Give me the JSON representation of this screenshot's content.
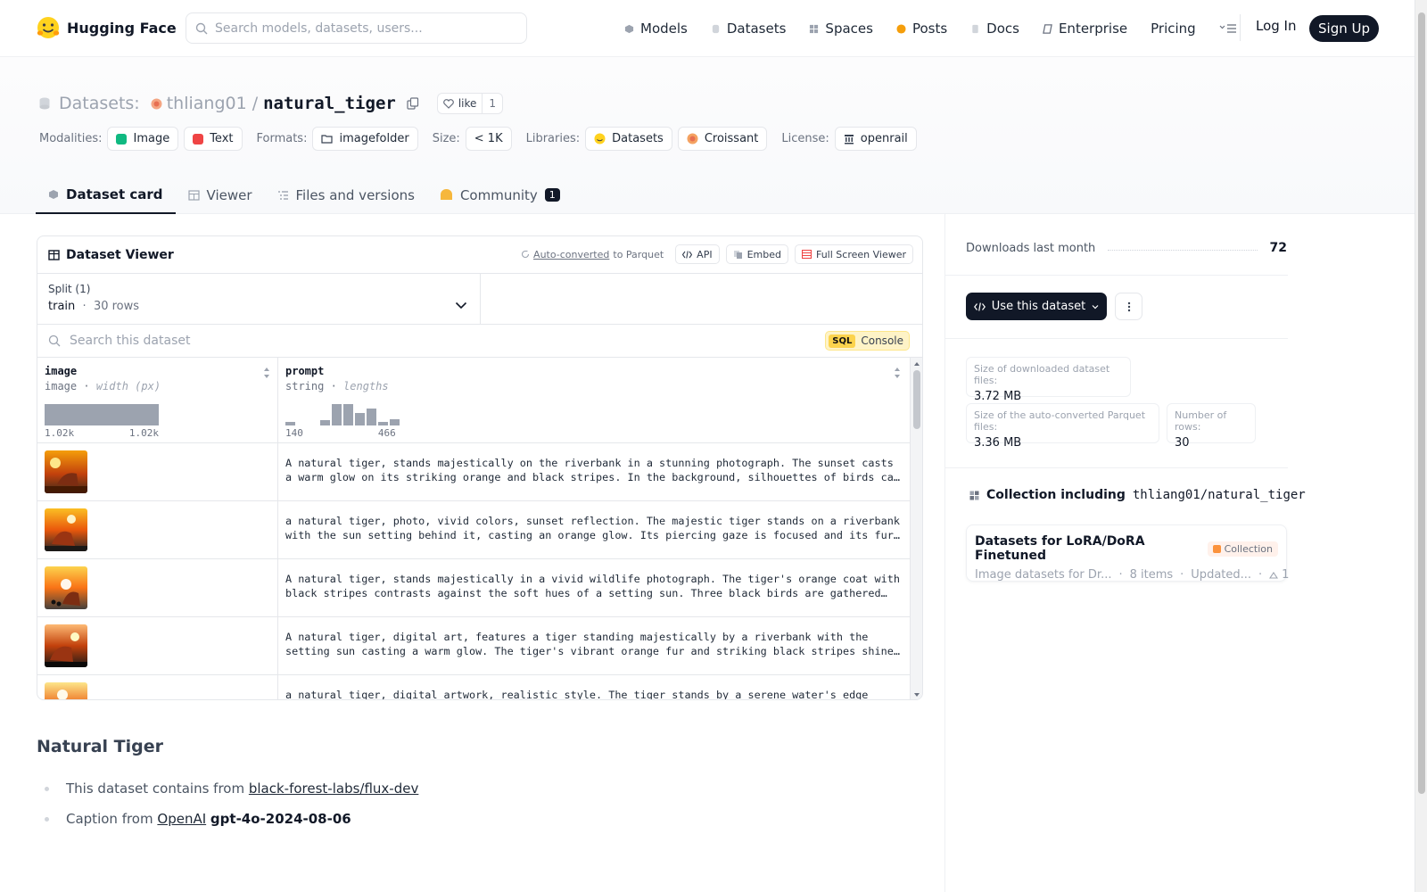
{
  "nav": {
    "brand": "Hugging Face",
    "search_placeholder": "Search models, datasets, users...",
    "links": [
      "Models",
      "Datasets",
      "Spaces",
      "Posts",
      "Docs",
      "Enterprise",
      "Pricing"
    ],
    "login": "Log In",
    "signup": "Sign Up"
  },
  "header": {
    "section": "Datasets:",
    "user": "thliang01",
    "slash": "/",
    "repo": "natural_tiger",
    "like_label": "like",
    "like_count": "1",
    "meta": {
      "modalities_label": "Modalities:",
      "modalities": [
        "Image",
        "Text"
      ],
      "formats_label": "Formats:",
      "format": "imagefolder",
      "size_label": "Size:",
      "size": "< 1K",
      "libraries_label": "Libraries:",
      "libraries": [
        "Datasets",
        "Croissant"
      ],
      "license_label": "License:",
      "license": "openrail"
    },
    "tabs": [
      {
        "label": "Dataset card"
      },
      {
        "label": "Viewer"
      },
      {
        "label": "Files and versions"
      },
      {
        "label": "Community",
        "badge": "1"
      }
    ]
  },
  "viewer": {
    "title": "Dataset Viewer",
    "auto_converted": "Auto-converted",
    "to_parquet": "to Parquet",
    "api": "API",
    "embed": "Embed",
    "fullscreen": "Full Screen Viewer",
    "split_label": "Split (1)",
    "split_name": "train",
    "split_sep": "·",
    "split_rows": "30 rows",
    "search_placeholder": "Search this dataset",
    "sql": "SQL",
    "console": "Console",
    "columns": [
      {
        "name": "image",
        "type": "image",
        "stat": "width (px)",
        "min": "1.02k",
        "max": "1.02k"
      },
      {
        "name": "prompt",
        "type": "string",
        "stat": "lengths",
        "min": "140",
        "max": "466"
      }
    ],
    "rows": [
      "A natural tiger, stands majestically on the riverbank in a stunning photograph. The sunset casts a warm glow on its striking orange and black stripes. In the background, silhouettes of birds can be seen against the vibrant sky.",
      "a natural tiger, photo, vivid colors, sunset reflection. The majestic tiger stands on a riverbank with the sun setting behind it, casting an orange glow. Its piercing gaze is focused and its fur glows in the warm light.",
      "A natural tiger, stands majestically in a vivid wildlife photograph. The tiger's orange coat with black stripes contrasts against the soft hues of a setting sun. Three black birds are gathered nearby on the ground.",
      "A natural tiger, digital art, features a tiger standing majestically by a riverbank with the setting sun casting a warm glow. The tiger's vibrant orange fur and striking black stripes shine in the light.",
      "a natural tiger, digital artwork, realistic style. The tiger stands by a serene water's edge under a glowing sky."
    ]
  },
  "card": {
    "title": "Natural Tiger",
    "item1_text": "This dataset contains from",
    "item1_link": "black-forest-labs/flux-dev",
    "item2_text": "Caption from",
    "item2_link": "OpenAI",
    "item2_bold": "gpt-4o-2024-08-06"
  },
  "sidebar": {
    "downloads_label": "Downloads last month",
    "downloads": "72",
    "use_dataset": "Use this dataset",
    "stats": [
      {
        "label": "Size of downloaded dataset files:",
        "value": "3.72 MB"
      },
      {
        "label": "Size of the auto-converted Parquet files:",
        "value": "3.36 MB"
      },
      {
        "label": "Number of rows:",
        "value": "30"
      }
    ],
    "collection_title": "Collection including",
    "collection_repo": "thliang01/natural_tiger",
    "collection": {
      "name": "Datasets for LoRA/DoRA Finetuned",
      "tag": "Collection",
      "desc": "Image datasets for Dr...",
      "items": "8 items",
      "updated": "Updated...",
      "upvotes": "1"
    }
  },
  "colors": {
    "accent": "#111827",
    "image_tag": "#10b981",
    "text_tag": "#ef4444",
    "sql_bg": "#fcd34d"
  }
}
